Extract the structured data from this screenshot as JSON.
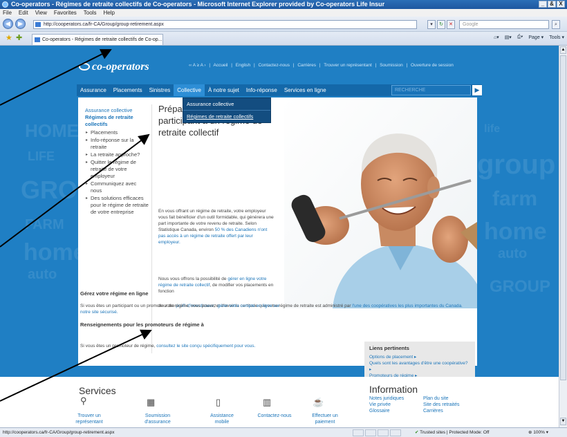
{
  "browser": {
    "window_title": "Co-operators - Régimes de retraite collectifs de Co-operators - Microsoft Internet Explorer provided by Co-operators Life Insur",
    "window_buttons": [
      "_",
      "&",
      "X"
    ],
    "menu": [
      "File",
      "Edit",
      "View",
      "Favorites",
      "Tools",
      "Help"
    ],
    "address": "http://cooperators.ca/fr-CA/Group/group-retirement.aspx",
    "search_placeholder": "Google",
    "tab_title": "Co-operators - Régimes de retraite collectifs de Co-op...",
    "tab_tools": [
      "Page ▾",
      "Tools ▾"
    ],
    "status_url": "http://cooperators.ca/fr-CA/Group/group-retirement.aspx",
    "status_zone": "Trusted sites | Protected Mode: Off",
    "zoom": "100%"
  },
  "site": {
    "logo": "co-operators",
    "top_links": [
      "‹‹ A ≥ A ›",
      "|",
      "Accueil",
      "|",
      "English",
      "|",
      "Contactez-nous",
      "|",
      "Carrières",
      "|",
      "Trouver un représentant",
      "|",
      "Soumission",
      "|",
      "Ouverture de session"
    ],
    "nav": [
      "Assurance",
      "Placements",
      "Sinistres",
      "Collective",
      "À notre sujet",
      "Info-réponse",
      "Services en ligne"
    ],
    "nav_active": "Collective",
    "search_placeholder": "RECHERCHE",
    "dropdown": [
      "Assurance collective",
      "Régimes de retraite collectifs"
    ],
    "background_words": [
      "HOME",
      "LIFE",
      "GROUP",
      "home",
      "FARM",
      "auto",
      "life",
      "group",
      "farm",
      "home",
      "auto",
      "GROUP"
    ]
  },
  "sidebar": {
    "parent": "Assurance collective",
    "current": "Régimes de retraite collectifs",
    "items": [
      "Placements",
      "Info-réponse sur la retraite",
      "La retraite approche?",
      "Quitter le régime de retraite de votre employeur",
      "Communiquez avec nous",
      "Des solutions efficaces pour le régime de retraite de votre entreprise"
    ]
  },
  "main": {
    "heading": "Préparez votre avenir en participant à un régime de retraite collectif",
    "intro_a": "En vous offrant un régime de retraite, votre employeur vous fait bénéficier d'un outil formidable, qui générera une part importante de votre revenu de retraite. Selon Statistique Canada, environ",
    "intro_link": "50 % des Canadiens n'ont pas accès à un régime de retraite offert par leur employeur.",
    "intro2_a": "Nous vous offrons la possibilité de",
    "intro2_link": "gérer en ligne votre régime de retraite collectif",
    "intro2_b": ", de modifier vos placements en fonction",
    "intro3_a": "de votre",
    "intro3_link1": "profil d'investisseur",
    "intro3_b": ", et d'avoir la certitude que votre régime de retraite est administré par",
    "intro3_link2": "l'une des coopératives les plus importantes du Canada.",
    "sec1_title": "Gérez votre régime en ligne",
    "sec1_a": "Si vous êtes un participant ou un promoteur de régime, vous pouvez",
    "sec1_link": "gérer votre compte en ligne sur notre site sécurisé.",
    "sec2_title": "Renseignements pour les promoteurs de régime à",
    "sec2_a": "Si vous êtes un promoteur de régime,",
    "sec2_link": "consultez le site conçu spécifiquement pour vous."
  },
  "related": {
    "title": "Liens pertinents",
    "links": [
      "Options de placement ▸",
      "Quels sont les avantages d'être une coopérative? ▸",
      "Promoteurs de régime ▸"
    ]
  },
  "footer": {
    "services_title": "Services",
    "services": [
      "Trouver un représentant",
      "Soumission d'assurance",
      "Assistance mobile",
      "Contactez-nous",
      "Effectuer un paiement"
    ],
    "info_title": "Information",
    "info_col1": [
      "Notes juridiques",
      "Vie privée",
      "Glossaire"
    ],
    "info_col2": [
      "Plan du site",
      "Site des retraités",
      "Carrières"
    ]
  },
  "colors": {
    "page_blue": "#1f7fc4",
    "nav_blue": "#1468a9",
    "link_blue": "#1a74b9",
    "dropdown_bg": "#134d80"
  }
}
